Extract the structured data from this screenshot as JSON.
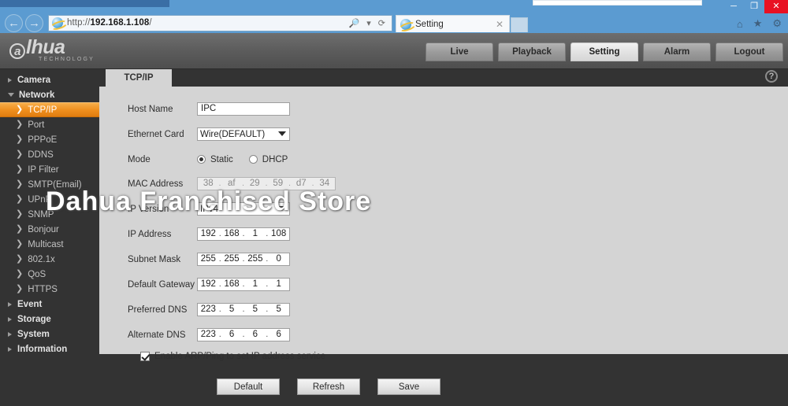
{
  "browser": {
    "back_icon": "back-arrow",
    "forward_icon": "forward-arrow",
    "url_prefix": "http://",
    "url_host": "192.168.1.108",
    "url_suffix": "/",
    "search_icon": "🔎",
    "refresh_icon": "⟳",
    "tab_title": "Setting",
    "tab_close": "✕",
    "home_icon": "⌂",
    "favorites_icon": "★",
    "tools_icon": "⚙",
    "minimize": "─",
    "maximize": "❐",
    "close": "✕"
  },
  "header": {
    "logo_mark": "a",
    "logo_text": "lhua",
    "logo_sub": "TECHNOLOGY",
    "nav": [
      {
        "label": "Live",
        "active": false
      },
      {
        "label": "Playback",
        "active": false
      },
      {
        "label": "Setting",
        "active": true
      },
      {
        "label": "Alarm",
        "active": false
      },
      {
        "label": "Logout",
        "active": false
      }
    ]
  },
  "sidebar": {
    "items": [
      {
        "label": "Camera",
        "level": 1,
        "arrow": "right",
        "active": false
      },
      {
        "label": "Network",
        "level": 1,
        "arrow": "down",
        "active": false
      },
      {
        "label": "TCP/IP",
        "level": 2,
        "arrow": "chevron",
        "active": true
      },
      {
        "label": "Port",
        "level": 2,
        "arrow": "chevron",
        "active": false
      },
      {
        "label": "PPPoE",
        "level": 2,
        "arrow": "chevron",
        "active": false
      },
      {
        "label": "DDNS",
        "level": 2,
        "arrow": "chevron",
        "active": false
      },
      {
        "label": "IP Filter",
        "level": 2,
        "arrow": "chevron",
        "active": false
      },
      {
        "label": "SMTP(Email)",
        "level": 2,
        "arrow": "chevron",
        "active": false
      },
      {
        "label": "UPnP",
        "level": 2,
        "arrow": "chevron",
        "active": false
      },
      {
        "label": "SNMP",
        "level": 2,
        "arrow": "chevron",
        "active": false
      },
      {
        "label": "Bonjour",
        "level": 2,
        "arrow": "chevron",
        "active": false
      },
      {
        "label": "Multicast",
        "level": 2,
        "arrow": "chevron",
        "active": false
      },
      {
        "label": "802.1x",
        "level": 2,
        "arrow": "chevron",
        "active": false
      },
      {
        "label": "QoS",
        "level": 2,
        "arrow": "chevron",
        "active": false
      },
      {
        "label": "HTTPS",
        "level": 2,
        "arrow": "chevron",
        "active": false
      },
      {
        "label": "Event",
        "level": 1,
        "arrow": "right",
        "active": false
      },
      {
        "label": "Storage",
        "level": 1,
        "arrow": "right",
        "active": false
      },
      {
        "label": "System",
        "level": 1,
        "arrow": "right",
        "active": false
      },
      {
        "label": "Information",
        "level": 1,
        "arrow": "right",
        "active": false
      }
    ]
  },
  "content": {
    "tab_label": "TCP/IP",
    "help_icon": "?",
    "fields": {
      "host_name": {
        "label": "Host Name",
        "value": "IPC"
      },
      "ethernet_card": {
        "label": "Ethernet Card",
        "value": "Wire(DEFAULT)"
      },
      "mode": {
        "label": "Mode",
        "option_static": "Static",
        "option_dhcp": "DHCP",
        "selected": "Static"
      },
      "mac_address": {
        "label": "MAC Address",
        "octets": [
          "38",
          "af",
          "29",
          "59",
          "d7",
          "34"
        ],
        "separator": ".",
        "disabled": true
      },
      "ip_version": {
        "label": "IP Version",
        "value": "IPv4"
      },
      "ip_address": {
        "label": "IP Address",
        "octets": [
          "192",
          "168",
          "1",
          "108"
        ],
        "separator": "."
      },
      "subnet_mask": {
        "label": "Subnet Mask",
        "octets": [
          "255",
          "255",
          "255",
          "0"
        ],
        "separator": "."
      },
      "default_gateway": {
        "label": "Default Gateway",
        "octets": [
          "192",
          "168",
          "1",
          "1"
        ],
        "separator": "."
      },
      "preferred_dns": {
        "label": "Preferred DNS",
        "octets": [
          "223",
          "5",
          "5",
          "5"
        ],
        "separator": "."
      },
      "alternate_dns": {
        "label": "Alternate DNS",
        "octets": [
          "223",
          "6",
          "6",
          "6"
        ],
        "separator": "."
      }
    },
    "arp_checkbox": {
      "label": "Enable ARP/Ping to set IP address service",
      "checked": true
    },
    "buttons": [
      {
        "label": "Default"
      },
      {
        "label": "Refresh"
      },
      {
        "label": "Save"
      }
    ]
  },
  "watermark": {
    "text": "Dahua Franchised Store"
  },
  "colors": {
    "accent_orange": "#ef8f1e",
    "panel_gray": "#d4d4d4",
    "app_dark": "#333333",
    "desktop_blue": "#5b9bd1",
    "close_red": "#e81123"
  }
}
